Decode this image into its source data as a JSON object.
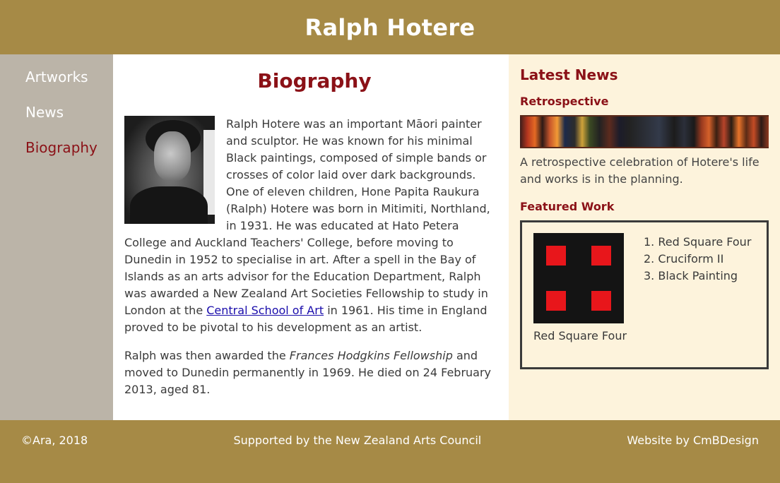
{
  "header": {
    "title": "Ralph Hotere"
  },
  "nav": {
    "items": [
      {
        "label": "Artworks"
      },
      {
        "label": "News"
      },
      {
        "label": "Biography"
      }
    ]
  },
  "main": {
    "title": "Biography",
    "paragraph1_before_link": "Ralph Hotere was an important Māori painter and sculptor. He was known for his minimal Black paintings, composed of simple bands or crosses of color laid over dark backgrounds. One of eleven children, Hone Papita Raukura (Ralph) Hotere was born in Mitimiti, Northland, in 1931. He was educated at Hato Petera College and Auckland Teachers' College, before moving to Dunedin in 1952 to specialise in art. After a spell in the Bay of Islands as an arts advisor for the Education Department, Ralph was awarded a New Zealand Art Societies Fellowship to study in London at the ",
    "link_label": "Central School of Art",
    "paragraph1_after_link": " in 1961. His time in England proved to be pivotal to his development as an artist.",
    "paragraph2_before_italic": "Ralph was then awarded the ",
    "paragraph2_italic": "Frances Hodgkins Fellowship",
    "paragraph2_after_italic": " and moved to Dunedin permanently in 1969. He died on 24 February 2013, aged 81."
  },
  "aside": {
    "title": "Latest News",
    "news_heading": "Retrospective",
    "news_text": "A retrospective celebration of Hotere's life and works is in the planning.",
    "featured_heading": "Featured Work",
    "featured_caption": "Red Square Four",
    "featured_list": [
      "1. Red Square Four",
      "2. Cruciform II",
      "3. Black Painting"
    ]
  },
  "footer": {
    "copyright": "©Ara, 2018",
    "supported": "Supported by the New Zealand Arts Council",
    "credit": "Website by CmBDesign"
  },
  "colors": {
    "header_bg": "#a68a46",
    "sidebar_bg": "#bbb4a8",
    "aside_bg": "#fdf3dc",
    "accent": "#8b1117"
  }
}
